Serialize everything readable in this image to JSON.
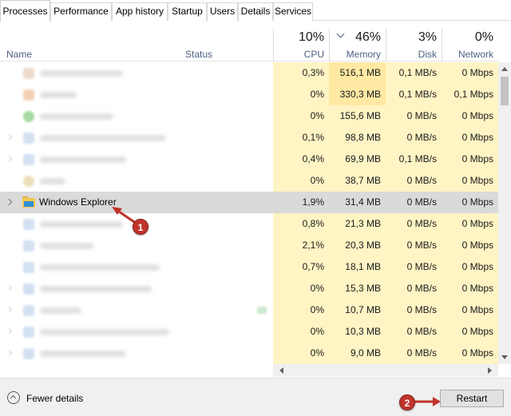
{
  "tabs": [
    {
      "label": "Processes",
      "active": true
    },
    {
      "label": "Performance",
      "active": false
    },
    {
      "label": "App history",
      "active": false
    },
    {
      "label": "Startup",
      "active": false
    },
    {
      "label": "Users",
      "active": false
    },
    {
      "label": "Details",
      "active": false
    },
    {
      "label": "Services",
      "active": false
    }
  ],
  "header": {
    "name": "Name",
    "status": "Status",
    "cpu": {
      "pct": "10%",
      "label": "CPU"
    },
    "memory": {
      "pct": "46%",
      "label": "Memory"
    },
    "disk": {
      "pct": "3%",
      "label": "Disk"
    },
    "network": {
      "pct": "0%",
      "label": "Network"
    }
  },
  "rows": [
    {
      "cpu": "0,3%",
      "memory": "516,1 MB",
      "disk": "0,1 MB/s",
      "network": "0 Mbps"
    },
    {
      "cpu": "0%",
      "memory": "330,3 MB",
      "disk": "0,1 MB/s",
      "network": "0,1 Mbps"
    },
    {
      "cpu": "0%",
      "memory": "155,6 MB",
      "disk": "0 MB/s",
      "network": "0 Mbps"
    },
    {
      "cpu": "0,1%",
      "memory": "98,8 MB",
      "disk": "0 MB/s",
      "network": "0 Mbps"
    },
    {
      "cpu": "0,4%",
      "memory": "69,9 MB",
      "disk": "0,1 MB/s",
      "network": "0 Mbps"
    },
    {
      "cpu": "0%",
      "memory": "38,7 MB",
      "disk": "0 MB/s",
      "network": "0 Mbps"
    },
    {
      "name": "Windows Explorer",
      "cpu": "1,9%",
      "memory": "31,4 MB",
      "disk": "0 MB/s",
      "network": "0 Mbps"
    },
    {
      "cpu": "0,8%",
      "memory": "21,3 MB",
      "disk": "0 MB/s",
      "network": "0 Mbps"
    },
    {
      "cpu": "2,1%",
      "memory": "20,3 MB",
      "disk": "0 MB/s",
      "network": "0 Mbps"
    },
    {
      "cpu": "0,7%",
      "memory": "18,1 MB",
      "disk": "0 MB/s",
      "network": "0 Mbps"
    },
    {
      "cpu": "0%",
      "memory": "15,3 MB",
      "disk": "0 MB/s",
      "network": "0 Mbps"
    },
    {
      "cpu": "0%",
      "memory": "10,7 MB",
      "disk": "0 MB/s",
      "network": "0 Mbps"
    },
    {
      "cpu": "0%",
      "memory": "10,3 MB",
      "disk": "0 MB/s",
      "network": "0 Mbps"
    },
    {
      "cpu": "0%",
      "memory": "9,0 MB",
      "disk": "0 MB/s",
      "network": "0 Mbps"
    }
  ],
  "footer": {
    "fewer_details": "Fewer details",
    "restart": "Restart"
  },
  "annotations": {
    "badge1": "1",
    "badge2": "2",
    "color": "#c0342b"
  },
  "colors": {
    "cell_light": "#fff4c4",
    "cell_medium": "#ffe9a3",
    "selected_row": "#dadada"
  }
}
